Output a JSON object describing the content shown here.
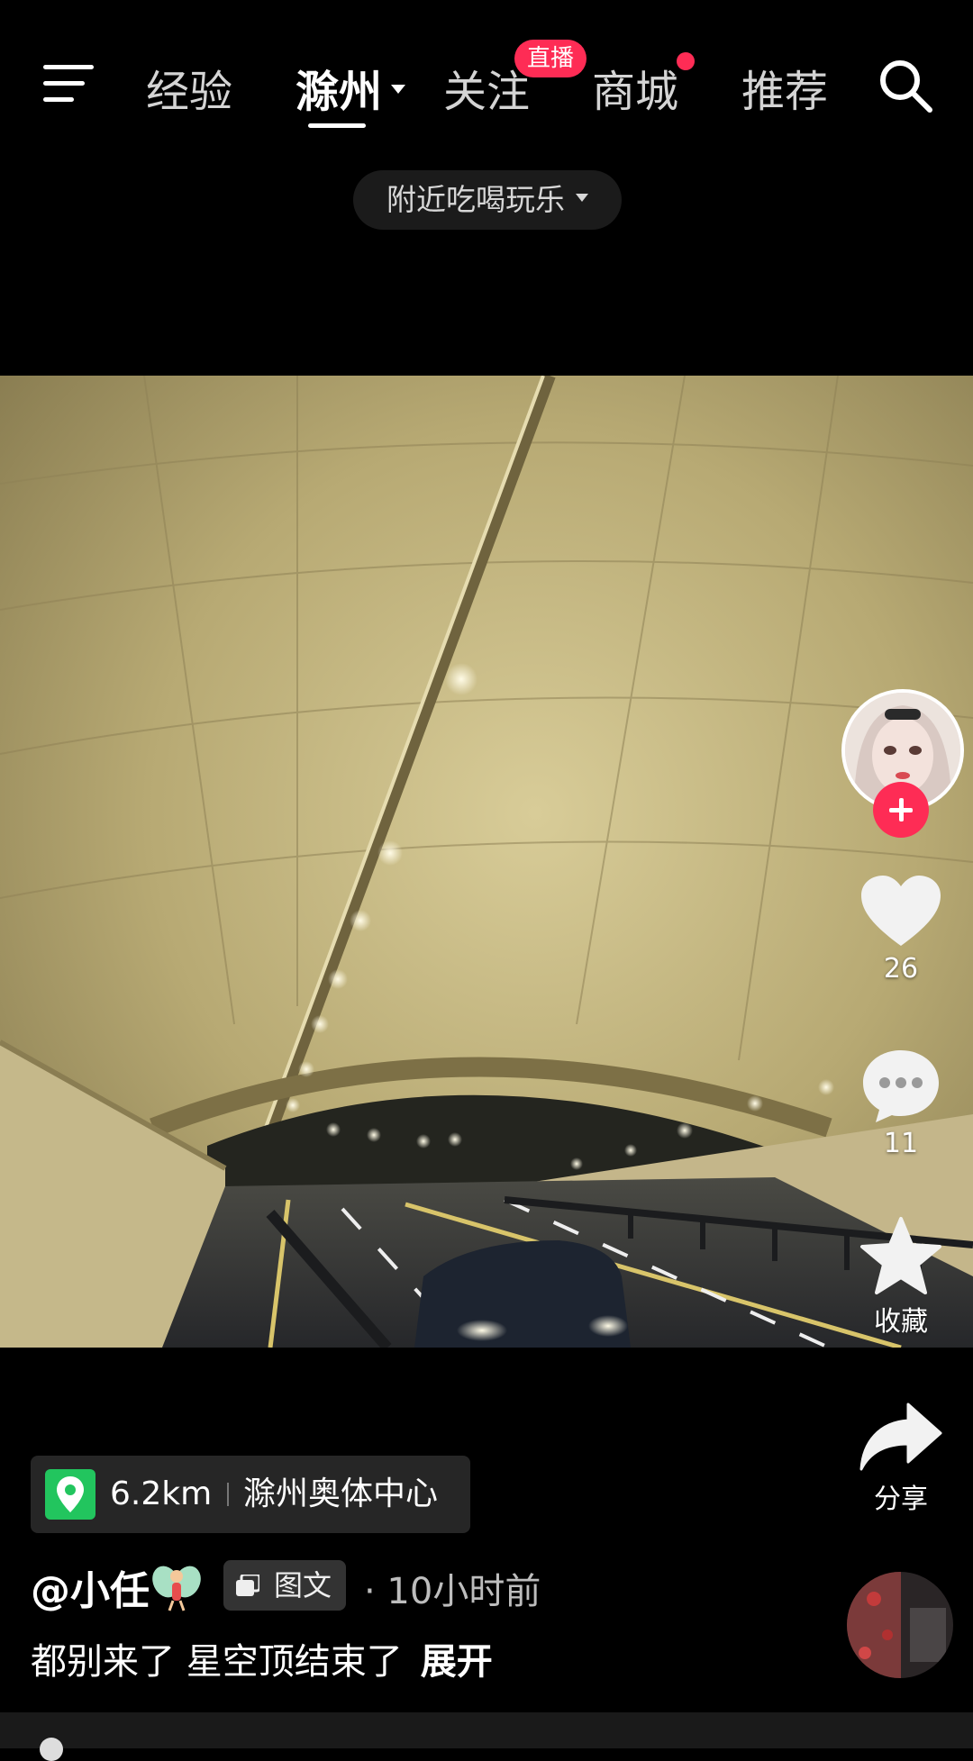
{
  "nav": {
    "tabs": [
      {
        "label": "经验"
      },
      {
        "label": "滁州"
      },
      {
        "label": "关注"
      },
      {
        "label": "商城"
      },
      {
        "label": "推荐"
      }
    ],
    "live_badge": "直播",
    "active_tab": "滁州"
  },
  "filter": {
    "label": "附近吃喝玩乐"
  },
  "actions": {
    "like_count": "26",
    "comment_count": "11",
    "favorite_label": "收藏",
    "share_label": "分享"
  },
  "location": {
    "distance": "6.2km",
    "name": "滁州奥体中心"
  },
  "post": {
    "author": "@小任",
    "type_label": "图文",
    "time": "· 10小时前",
    "description": "都别来了 星空顶结束了",
    "expand_label": "展开"
  },
  "colors": {
    "accent": "#fe2c55",
    "location_pin": "#22c55e"
  }
}
